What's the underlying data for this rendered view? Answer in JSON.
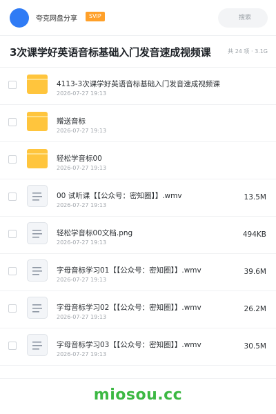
{
  "header": {
    "brand": "夸克网盘分享",
    "badge": "SVIP",
    "search_placeholder": "搜索"
  },
  "share": {
    "title": "3次课学好英语音标基础入门发音速成视频课",
    "meta": "共 24 项 · 3.1G"
  },
  "files": [
    {
      "type": "folder",
      "name": "4113-3次课学好英语音标基础入门发音速成视频课",
      "date": "2026-07-27 19:13",
      "size": ""
    },
    {
      "type": "folder",
      "name": "赠送音标",
      "date": "2026-07-27 19:13",
      "size": ""
    },
    {
      "type": "folder",
      "name": "轻松学音标00",
      "date": "2026-07-27 19:13",
      "size": ""
    },
    {
      "type": "file",
      "name": "00 试听课【【公众号：密知圈】】.wmv",
      "date": "2026-07-27 19:13",
      "size": "13.5M"
    },
    {
      "type": "file",
      "name": "轻松学音标00文档.png",
      "date": "2026-07-27 19:13",
      "size": "494KB"
    },
    {
      "type": "file",
      "name": "字母音标学习01【【公众号：密知圈】】.wmv",
      "date": "2026-07-27 19:13",
      "size": "39.6M"
    },
    {
      "type": "file",
      "name": "字母音标学习02【【公众号：密知圈】】.wmv",
      "date": "2026-07-27 19:13",
      "size": "26.2M"
    },
    {
      "type": "file",
      "name": "字母音标学习03【【公众号：密知圈】】.wmv",
      "date": "2026-07-27 19:13",
      "size": "30.5M"
    }
  ],
  "icons": {
    "folder": "folder-icon",
    "file": "document-icon"
  },
  "colors": {
    "accent": "#2f7bf5",
    "badge": "#ffa029",
    "folder": "#ffc53d",
    "watermark": "#3cb843"
  },
  "watermark": "miosou.cc"
}
